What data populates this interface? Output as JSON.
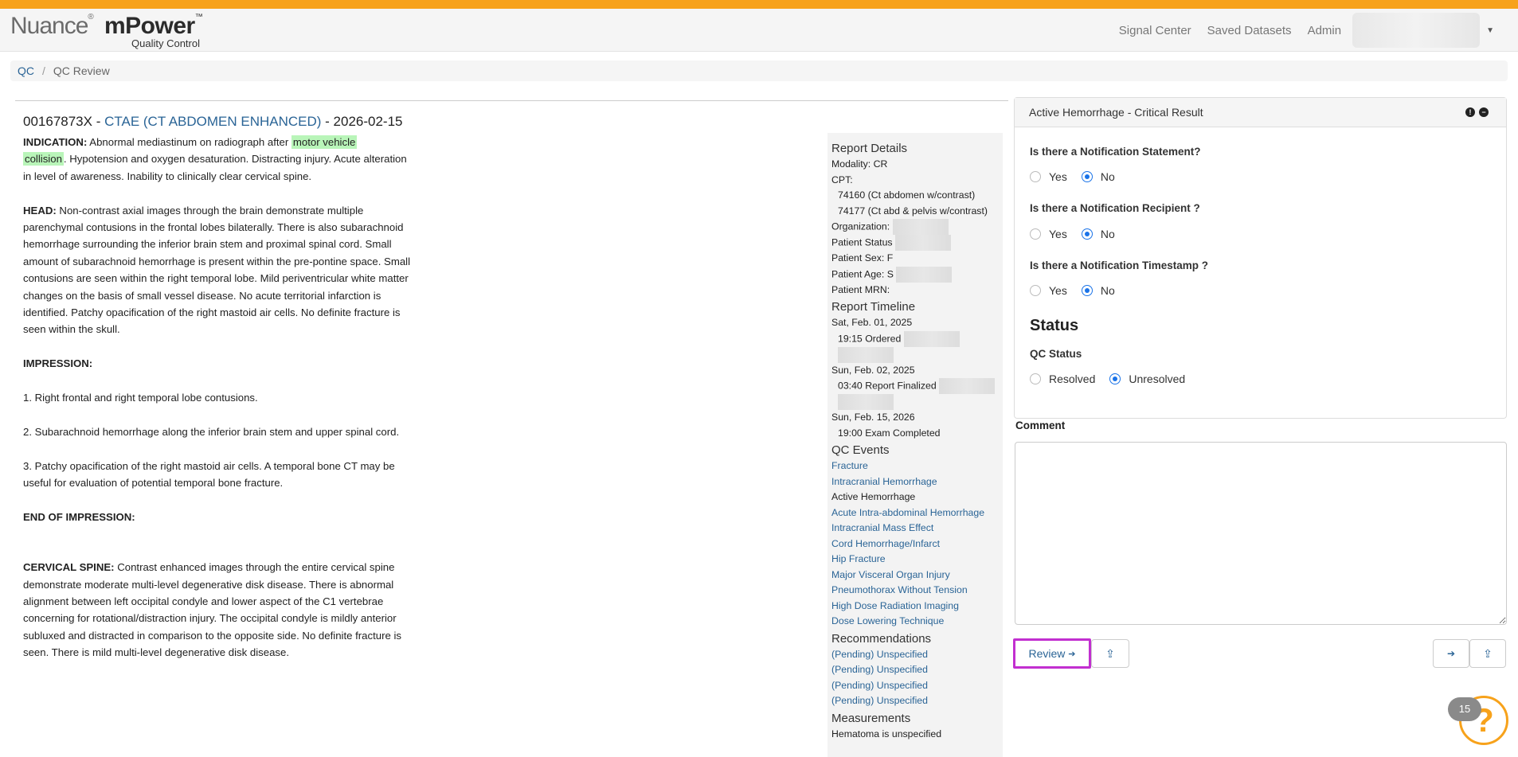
{
  "brand": {
    "name1": "Nuance",
    "name2": "mPower",
    "tm": "™",
    "reg": "®",
    "sub": "Quality Control"
  },
  "nav": {
    "links": [
      "Signal Center",
      "Saved Datasets",
      "Admin"
    ]
  },
  "breadcrumb": {
    "root": "QC",
    "current": "QC Review"
  },
  "report": {
    "accession": "00167873X - ",
    "exam_link": "CTAE (CT ABDOMEN ENHANCED)",
    "date": " - 2026-02-15",
    "indication_label": "INDICATION:",
    "indication_pre": " Abnormal mediastinum on radiograph after ",
    "indication_hl1": "motor vehicle",
    "indication_hl2": "collision",
    "indication_post": ". Hypotension and oxygen desaturation. Distracting injury. Acute alteration in level of awareness. Inability to clinically clear cervical spine.",
    "head_label": "HEAD:",
    "head_text": " Non-contrast axial images through the brain demonstrate multiple parenchymal contusions in the frontal lobes bilaterally. There is also subarachnoid hemorrhage surrounding the inferior brain stem and proximal spinal cord. Small amount of subarachnoid hemorrhage is present within the pre-pontine space. Small contusions are seen within the right temporal lobe. Mild periventricular white matter changes on the basis of small vessel disease. No acute territorial infarction is identified. Patchy opacification of the right mastoid air cells. No definite fracture is seen within the skull.",
    "impression_label": "IMPRESSION:",
    "imp1": "1. Right frontal and right temporal lobe contusions.",
    "imp2": "2. Subarachnoid hemorrhage along the inferior brain stem and upper spinal cord.",
    "imp3": "3. Patchy opacification of the right mastoid air cells. A temporal bone CT may be useful for evaluation of potential temporal bone fracture.",
    "end_label": "END OF IMPRESSION:",
    "cspine_label": "CERVICAL SPINE:",
    "cspine_text": " Contrast enhanced images through the entire cervical spine demonstrate moderate multi-level degenerative disk disease. There is abnormal alignment between left occipital condyle and lower aspect of the C1 vertebrae concerning for rotational/distraction injury. The occipital condyle is mildly anterior subluxed and distracted in comparison to the opposite side. No definite fracture is seen. There is mild multi-level degenerative disk disease."
  },
  "details": {
    "header": "Report Details",
    "modality": "Modality: CR",
    "cpt_label": "CPT:",
    "cpt1": "74160 (Ct abdomen w/contrast)",
    "cpt2": "74177 (Ct abd & pelvis w/contrast)",
    "org": "Organization:",
    "pstatus": "Patient Status",
    "psex": "Patient Sex: F",
    "page": "Patient Age: S",
    "pmrn": "Patient MRN: ",
    "timeline_header": "Report Timeline",
    "t1_date": "Sat, Feb. 01, 2025",
    "t1_event": "19:15 Ordered",
    "t2_date": "Sun, Feb. 02, 2025",
    "t2_event": "03:40 Report Finalized",
    "t3_date": "Sun, Feb. 15, 2026",
    "t3_event": "19:00 Exam Completed",
    "qc_header": "QC Events",
    "qc_events": [
      "Fracture",
      "Intracranial Hemorrhage",
      "Active Hemorrhage",
      "Acute Intra-abdominal Hemorrhage",
      "Intracranial Mass Effect",
      "Cord Hemorrhage/Infarct",
      "Hip Fracture",
      "Major Visceral Organ Injury",
      "Pneumothorax Without Tension",
      "High Dose Radiation Imaging",
      "Dose Lowering Technique"
    ],
    "rec_header": "Recommendations",
    "recs": [
      "(Pending) Unspecified",
      "(Pending) Unspecified",
      "(Pending) Unspecified",
      "(Pending) Unspecified"
    ],
    "meas_header": "Measurements",
    "meas1": "Hematoma is unspecified"
  },
  "panel": {
    "title": "Active Hemorrhage - Critical Result",
    "info_glyph": "!",
    "collapse_glyph": "−",
    "q1": "Is there a Notification Statement?",
    "q2": "Is there a Notification Recipient ?",
    "q3": "Is there a Notification Timestamp ?",
    "yes": "Yes",
    "no": "No",
    "status_header": "Status",
    "qc_status_label": "QC Status",
    "resolved": "Resolved",
    "unresolved": "Unresolved"
  },
  "comment_label": "Comment",
  "buttons": {
    "review": "Review",
    "arrow": "➔",
    "share_glyph": "⇪",
    "next_glyph": "➔"
  },
  "help": {
    "badge": "15",
    "glyph": "?"
  },
  "colors": {
    "accent": "#f7a21b",
    "link": "#2a6496",
    "highlight": "#b9f5b9",
    "review_outline": "#c22fd0"
  }
}
